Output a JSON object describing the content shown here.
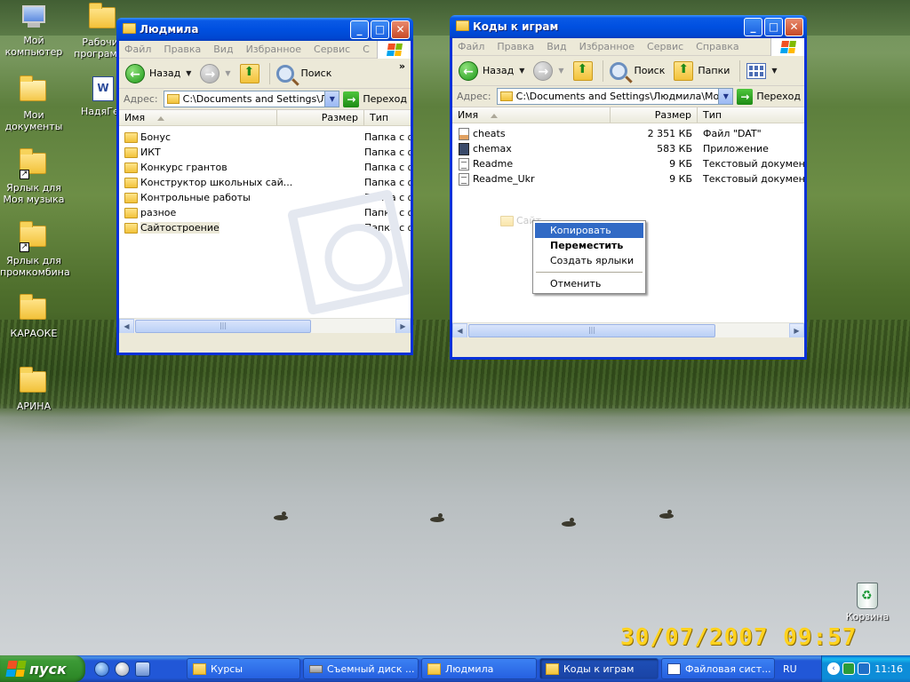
{
  "desktop": {
    "icons": [
      {
        "label": "Мой компьютер"
      },
      {
        "label": "Рабочие программы"
      },
      {
        "label": "Мои документы"
      },
      {
        "label": "НадяГен"
      },
      {
        "label": "Ярлык для Моя музыка"
      },
      {
        "label": "Ярлык для промкомбина"
      },
      {
        "label": "КАРАОКЕ"
      },
      {
        "label": "АРИНА"
      }
    ],
    "recycle_bin": "Корзина",
    "photo_timestamp": "30/07/2007  09:57"
  },
  "window_left": {
    "title": "Людмила",
    "menu": [
      "Файл",
      "Правка",
      "Вид",
      "Избранное",
      "Сервис",
      "С"
    ],
    "toolbar": {
      "back": "Назад",
      "search": "Поиск",
      "more": "»"
    },
    "address_label": "Адрес:",
    "address": "C:\\Documents and Settings\\Людмила",
    "go": "Переход",
    "columns": {
      "name": "Имя",
      "size": "Размер",
      "type": "Тип"
    },
    "rows": [
      {
        "name": "Бонус",
        "type": "Папка с ф"
      },
      {
        "name": "ИКТ",
        "type": "Папка с ф"
      },
      {
        "name": "Конкурс грантов",
        "type": "Папка с ф"
      },
      {
        "name": "Конструктор школьных сай...",
        "type": "Папка с ф"
      },
      {
        "name": "Контрольные работы",
        "type": "Папка с ф"
      },
      {
        "name": "разное",
        "type": "Папка с ф"
      },
      {
        "name": "Сайтостроение",
        "type": "Папка с ф"
      }
    ],
    "scroll_thumb": "|||"
  },
  "window_right": {
    "title": "Коды к играм",
    "menu": [
      "Файл",
      "Правка",
      "Вид",
      "Избранное",
      "Сервис",
      "Справка"
    ],
    "toolbar": {
      "back": "Назад",
      "search": "Поиск",
      "folders": "Папки"
    },
    "address_label": "Адрес:",
    "address": "C:\\Documents and Settings\\Людмила\\Мои доку",
    "go": "Переход",
    "columns": {
      "name": "Имя",
      "size": "Размер",
      "type": "Тип"
    },
    "rows": [
      {
        "name": "cheats",
        "size": "2 351 КБ",
        "type": "Файл \"DAT\"",
        "icon": "dat"
      },
      {
        "name": "chemax",
        "size": "583 КБ",
        "type": "Приложение",
        "icon": "app"
      },
      {
        "name": "Readme",
        "size": "9 КБ",
        "type": "Текстовый документ",
        "icon": "txt"
      },
      {
        "name": "Readme_Ukr",
        "size": "9 КБ",
        "type": "Текстовый документ",
        "icon": "txt"
      }
    ],
    "drag_ghost": "Сайт",
    "scroll_thumb": "|||"
  },
  "context_menu": {
    "copy": "Копировать",
    "move": "Переместить",
    "shortcuts": "Создать ярлыки",
    "cancel": "Отменить"
  },
  "taskbar": {
    "start": "пуск",
    "tasks": [
      "Курсы",
      "Съемный диск ...",
      "Людмила",
      "Коды к играм",
      "Файловая сист..."
    ],
    "lang": "RU",
    "clock": "11:16"
  }
}
